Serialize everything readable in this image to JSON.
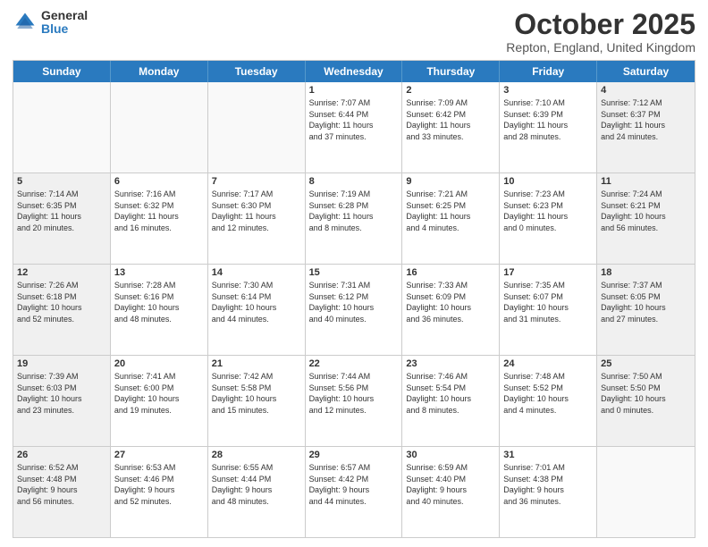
{
  "header": {
    "logo_general": "General",
    "logo_blue": "Blue",
    "month_title": "October 2025",
    "location": "Repton, England, United Kingdom"
  },
  "weekdays": [
    "Sunday",
    "Monday",
    "Tuesday",
    "Wednesday",
    "Thursday",
    "Friday",
    "Saturday"
  ],
  "rows": [
    [
      {
        "day": "",
        "text": "",
        "empty": true
      },
      {
        "day": "",
        "text": "",
        "empty": true
      },
      {
        "day": "",
        "text": "",
        "empty": true
      },
      {
        "day": "1",
        "text": "Sunrise: 7:07 AM\nSunset: 6:44 PM\nDaylight: 11 hours\nand 37 minutes.",
        "empty": false
      },
      {
        "day": "2",
        "text": "Sunrise: 7:09 AM\nSunset: 6:42 PM\nDaylight: 11 hours\nand 33 minutes.",
        "empty": false
      },
      {
        "day": "3",
        "text": "Sunrise: 7:10 AM\nSunset: 6:39 PM\nDaylight: 11 hours\nand 28 minutes.",
        "empty": false
      },
      {
        "day": "4",
        "text": "Sunrise: 7:12 AM\nSunset: 6:37 PM\nDaylight: 11 hours\nand 24 minutes.",
        "empty": false,
        "shaded": true
      }
    ],
    [
      {
        "day": "5",
        "text": "Sunrise: 7:14 AM\nSunset: 6:35 PM\nDaylight: 11 hours\nand 20 minutes.",
        "empty": false,
        "shaded": true
      },
      {
        "day": "6",
        "text": "Sunrise: 7:16 AM\nSunset: 6:32 PM\nDaylight: 11 hours\nand 16 minutes.",
        "empty": false
      },
      {
        "day": "7",
        "text": "Sunrise: 7:17 AM\nSunset: 6:30 PM\nDaylight: 11 hours\nand 12 minutes.",
        "empty": false
      },
      {
        "day": "8",
        "text": "Sunrise: 7:19 AM\nSunset: 6:28 PM\nDaylight: 11 hours\nand 8 minutes.",
        "empty": false
      },
      {
        "day": "9",
        "text": "Sunrise: 7:21 AM\nSunset: 6:25 PM\nDaylight: 11 hours\nand 4 minutes.",
        "empty": false
      },
      {
        "day": "10",
        "text": "Sunrise: 7:23 AM\nSunset: 6:23 PM\nDaylight: 11 hours\nand 0 minutes.",
        "empty": false
      },
      {
        "day": "11",
        "text": "Sunrise: 7:24 AM\nSunset: 6:21 PM\nDaylight: 10 hours\nand 56 minutes.",
        "empty": false,
        "shaded": true
      }
    ],
    [
      {
        "day": "12",
        "text": "Sunrise: 7:26 AM\nSunset: 6:18 PM\nDaylight: 10 hours\nand 52 minutes.",
        "empty": false,
        "shaded": true
      },
      {
        "day": "13",
        "text": "Sunrise: 7:28 AM\nSunset: 6:16 PM\nDaylight: 10 hours\nand 48 minutes.",
        "empty": false
      },
      {
        "day": "14",
        "text": "Sunrise: 7:30 AM\nSunset: 6:14 PM\nDaylight: 10 hours\nand 44 minutes.",
        "empty": false
      },
      {
        "day": "15",
        "text": "Sunrise: 7:31 AM\nSunset: 6:12 PM\nDaylight: 10 hours\nand 40 minutes.",
        "empty": false
      },
      {
        "day": "16",
        "text": "Sunrise: 7:33 AM\nSunset: 6:09 PM\nDaylight: 10 hours\nand 36 minutes.",
        "empty": false
      },
      {
        "day": "17",
        "text": "Sunrise: 7:35 AM\nSunset: 6:07 PM\nDaylight: 10 hours\nand 31 minutes.",
        "empty": false
      },
      {
        "day": "18",
        "text": "Sunrise: 7:37 AM\nSunset: 6:05 PM\nDaylight: 10 hours\nand 27 minutes.",
        "empty": false,
        "shaded": true
      }
    ],
    [
      {
        "day": "19",
        "text": "Sunrise: 7:39 AM\nSunset: 6:03 PM\nDaylight: 10 hours\nand 23 minutes.",
        "empty": false,
        "shaded": true
      },
      {
        "day": "20",
        "text": "Sunrise: 7:41 AM\nSunset: 6:00 PM\nDaylight: 10 hours\nand 19 minutes.",
        "empty": false
      },
      {
        "day": "21",
        "text": "Sunrise: 7:42 AM\nSunset: 5:58 PM\nDaylight: 10 hours\nand 15 minutes.",
        "empty": false
      },
      {
        "day": "22",
        "text": "Sunrise: 7:44 AM\nSunset: 5:56 PM\nDaylight: 10 hours\nand 12 minutes.",
        "empty": false
      },
      {
        "day": "23",
        "text": "Sunrise: 7:46 AM\nSunset: 5:54 PM\nDaylight: 10 hours\nand 8 minutes.",
        "empty": false
      },
      {
        "day": "24",
        "text": "Sunrise: 7:48 AM\nSunset: 5:52 PM\nDaylight: 10 hours\nand 4 minutes.",
        "empty": false
      },
      {
        "day": "25",
        "text": "Sunrise: 7:50 AM\nSunset: 5:50 PM\nDaylight: 10 hours\nand 0 minutes.",
        "empty": false,
        "shaded": true
      }
    ],
    [
      {
        "day": "26",
        "text": "Sunrise: 6:52 AM\nSunset: 4:48 PM\nDaylight: 9 hours\nand 56 minutes.",
        "empty": false,
        "shaded": true
      },
      {
        "day": "27",
        "text": "Sunrise: 6:53 AM\nSunset: 4:46 PM\nDaylight: 9 hours\nand 52 minutes.",
        "empty": false
      },
      {
        "day": "28",
        "text": "Sunrise: 6:55 AM\nSunset: 4:44 PM\nDaylight: 9 hours\nand 48 minutes.",
        "empty": false
      },
      {
        "day": "29",
        "text": "Sunrise: 6:57 AM\nSunset: 4:42 PM\nDaylight: 9 hours\nand 44 minutes.",
        "empty": false
      },
      {
        "day": "30",
        "text": "Sunrise: 6:59 AM\nSunset: 4:40 PM\nDaylight: 9 hours\nand 40 minutes.",
        "empty": false
      },
      {
        "day": "31",
        "text": "Sunrise: 7:01 AM\nSunset: 4:38 PM\nDaylight: 9 hours\nand 36 minutes.",
        "empty": false
      },
      {
        "day": "",
        "text": "",
        "empty": true
      }
    ]
  ]
}
